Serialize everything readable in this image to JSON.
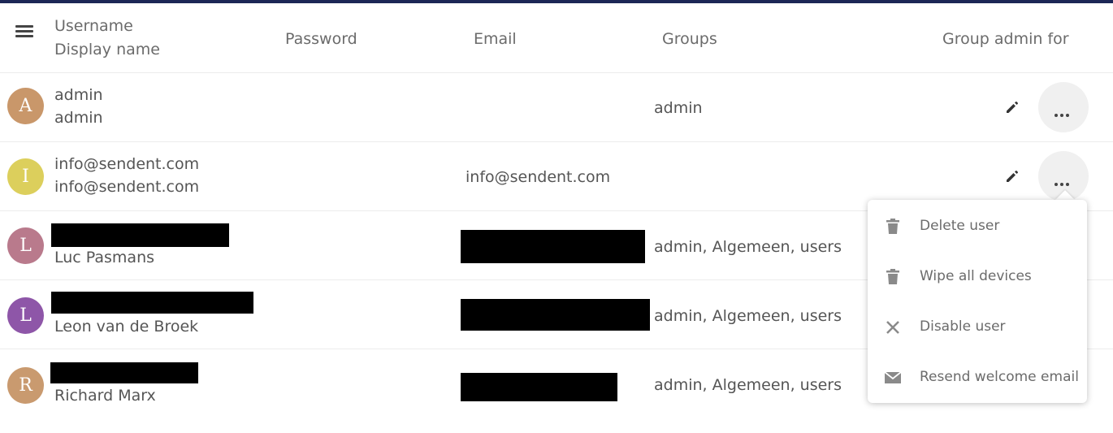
{
  "header": {
    "username_label": "Username",
    "display_name_label": "Display name",
    "password_label": "Password",
    "email_label": "Email",
    "groups_label": "Groups",
    "group_admin_label": "Group admin for"
  },
  "users": [
    {
      "avatar_letter": "A",
      "avatar_color": "#c9976a",
      "username": "admin",
      "display_name": "admin",
      "email": "",
      "groups": "admin"
    },
    {
      "avatar_letter": "I",
      "avatar_color": "#dccf5c",
      "username": "info@sendent.com",
      "display_name": "info@sendent.com",
      "email": "info@sendent.com",
      "groups": ""
    },
    {
      "avatar_letter": "L",
      "avatar_color": "#b97a8c",
      "username": "",
      "display_name": "Luc Pasmans",
      "email": "",
      "groups": "admin, Algemeen, users"
    },
    {
      "avatar_letter": "L",
      "avatar_color": "#8e56a8",
      "username": "",
      "display_name": "Leon van de Broek",
      "email": "",
      "groups": "admin, Algemeen, users"
    },
    {
      "avatar_letter": "R",
      "avatar_color": "#c99a6f",
      "username": "",
      "display_name": "Richard Marx",
      "email": "",
      "groups": "admin, Algemeen, users"
    }
  ],
  "actions_menu": {
    "items": [
      {
        "label": "Delete user",
        "icon": "trash-icon"
      },
      {
        "label": "Wipe all devices",
        "icon": "trash-icon"
      },
      {
        "label": "Disable user",
        "icon": "close-icon"
      },
      {
        "label": "Resend welcome email",
        "icon": "mail-icon"
      }
    ]
  },
  "colors": {
    "topbar": "#1c2756",
    "avatar_admin": "#c9976a",
    "avatar_info": "#dccf5c",
    "avatar_luc": "#b97a8c",
    "avatar_leon": "#8e56a8",
    "avatar_richard": "#c99a6f"
  }
}
